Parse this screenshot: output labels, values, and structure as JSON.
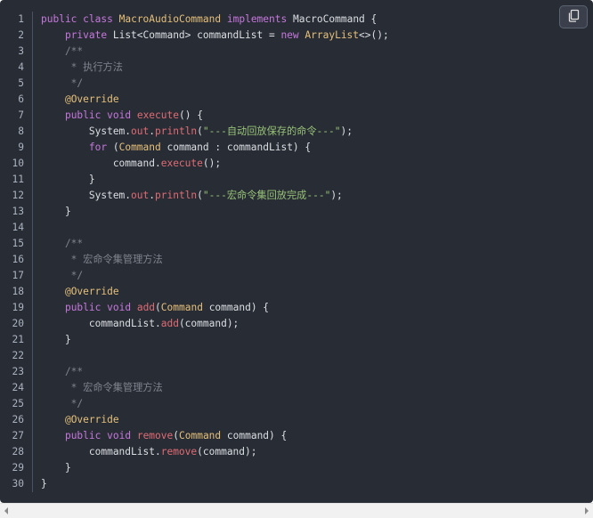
{
  "copy_button": {
    "icon": "copy-icon"
  },
  "colors": {
    "background": "#282c34",
    "keyword": "#c678dd",
    "class": "#e5c07b",
    "function": "#e06c75",
    "string": "#98c379",
    "comment": "#7f848e",
    "annotation": "#e5c07b",
    "plain": "#dcdfe4"
  },
  "code": {
    "lines": [
      {
        "n": "1",
        "tokens": [
          [
            "kw",
            "public"
          ],
          [
            "p",
            " "
          ],
          [
            "kw",
            "class"
          ],
          [
            "p",
            " "
          ],
          [
            "cls",
            "MacroAudioCommand"
          ],
          [
            "p",
            " "
          ],
          [
            "kw",
            "implements"
          ],
          [
            "p",
            " MacroCommand {"
          ]
        ]
      },
      {
        "n": "2",
        "tokens": [
          [
            "p",
            "    "
          ],
          [
            "kw",
            "private"
          ],
          [
            "p",
            " List<Command> commandList = "
          ],
          [
            "kw",
            "new"
          ],
          [
            "p",
            " "
          ],
          [
            "cls",
            "ArrayList"
          ],
          [
            "p",
            "<>();"
          ]
        ]
      },
      {
        "n": "3",
        "tokens": [
          [
            "com",
            "    /**"
          ]
        ]
      },
      {
        "n": "4",
        "tokens": [
          [
            "com",
            "     * 执行方法"
          ]
        ]
      },
      {
        "n": "5",
        "tokens": [
          [
            "com",
            "     */"
          ]
        ]
      },
      {
        "n": "6",
        "tokens": [
          [
            "p",
            "    "
          ],
          [
            "ann",
            "@Override"
          ]
        ]
      },
      {
        "n": "7",
        "tokens": [
          [
            "p",
            "    "
          ],
          [
            "kw",
            "public"
          ],
          [
            "p",
            " "
          ],
          [
            "kw",
            "void"
          ],
          [
            "p",
            " "
          ],
          [
            "fn",
            "execute"
          ],
          [
            "p",
            "() {"
          ]
        ]
      },
      {
        "n": "8",
        "tokens": [
          [
            "p",
            "        System."
          ],
          [
            "fn",
            "out"
          ],
          [
            "p",
            "."
          ],
          [
            "fn",
            "println"
          ],
          [
            "p",
            "("
          ],
          [
            "str",
            "\"---自动回放保存的命令---\""
          ],
          [
            "p",
            ");"
          ]
        ]
      },
      {
        "n": "9",
        "tokens": [
          [
            "p",
            "        "
          ],
          [
            "kw",
            "for"
          ],
          [
            "p",
            " ("
          ],
          [
            "cls",
            "Command"
          ],
          [
            "p",
            " command : commandList) {"
          ]
        ]
      },
      {
        "n": "10",
        "tokens": [
          [
            "p",
            "            command."
          ],
          [
            "fn",
            "execute"
          ],
          [
            "p",
            "();"
          ]
        ]
      },
      {
        "n": "11",
        "tokens": [
          [
            "p",
            "        }"
          ]
        ]
      },
      {
        "n": "12",
        "tokens": [
          [
            "p",
            "        System."
          ],
          [
            "fn",
            "out"
          ],
          [
            "p",
            "."
          ],
          [
            "fn",
            "println"
          ],
          [
            "p",
            "("
          ],
          [
            "str",
            "\"---宏命令集回放完成---\""
          ],
          [
            "p",
            ");"
          ]
        ]
      },
      {
        "n": "13",
        "tokens": [
          [
            "p",
            "    }"
          ]
        ]
      },
      {
        "n": "14",
        "tokens": [
          [
            "p",
            ""
          ]
        ]
      },
      {
        "n": "15",
        "tokens": [
          [
            "com",
            "    /**"
          ]
        ]
      },
      {
        "n": "16",
        "tokens": [
          [
            "com",
            "     * 宏命令集管理方法"
          ]
        ]
      },
      {
        "n": "17",
        "tokens": [
          [
            "com",
            "     */"
          ]
        ]
      },
      {
        "n": "18",
        "tokens": [
          [
            "p",
            "    "
          ],
          [
            "ann",
            "@Override"
          ]
        ]
      },
      {
        "n": "19",
        "tokens": [
          [
            "p",
            "    "
          ],
          [
            "kw",
            "public"
          ],
          [
            "p",
            " "
          ],
          [
            "kw",
            "void"
          ],
          [
            "p",
            " "
          ],
          [
            "fn",
            "add"
          ],
          [
            "p",
            "("
          ],
          [
            "cls",
            "Command"
          ],
          [
            "p",
            " command) {"
          ]
        ]
      },
      {
        "n": "20",
        "tokens": [
          [
            "p",
            "        commandList."
          ],
          [
            "fn",
            "add"
          ],
          [
            "p",
            "(command);"
          ]
        ]
      },
      {
        "n": "21",
        "tokens": [
          [
            "p",
            "    }"
          ]
        ]
      },
      {
        "n": "22",
        "tokens": [
          [
            "p",
            ""
          ]
        ]
      },
      {
        "n": "23",
        "tokens": [
          [
            "com",
            "    /**"
          ]
        ]
      },
      {
        "n": "24",
        "tokens": [
          [
            "com",
            "     * 宏命令集管理方法"
          ]
        ]
      },
      {
        "n": "25",
        "tokens": [
          [
            "com",
            "     */"
          ]
        ]
      },
      {
        "n": "26",
        "tokens": [
          [
            "p",
            "    "
          ],
          [
            "ann",
            "@Override"
          ]
        ]
      },
      {
        "n": "27",
        "tokens": [
          [
            "p",
            "    "
          ],
          [
            "kw",
            "public"
          ],
          [
            "p",
            " "
          ],
          [
            "kw",
            "void"
          ],
          [
            "p",
            " "
          ],
          [
            "fn",
            "remove"
          ],
          [
            "p",
            "("
          ],
          [
            "cls",
            "Command"
          ],
          [
            "p",
            " command) {"
          ]
        ]
      },
      {
        "n": "28",
        "tokens": [
          [
            "p",
            "        commandList."
          ],
          [
            "fn",
            "remove"
          ],
          [
            "p",
            "(command);"
          ]
        ]
      },
      {
        "n": "29",
        "tokens": [
          [
            "p",
            "    }"
          ]
        ]
      },
      {
        "n": "30",
        "tokens": [
          [
            "p",
            "}"
          ]
        ]
      }
    ]
  }
}
